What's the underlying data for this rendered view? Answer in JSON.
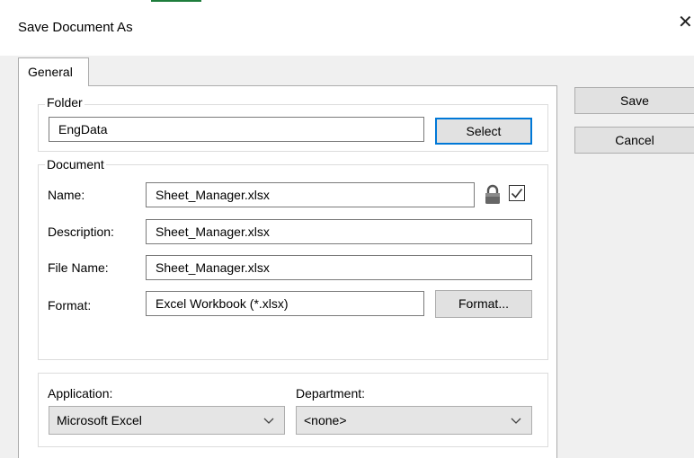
{
  "window": {
    "title": "Save Document As",
    "close_glyph": "✕"
  },
  "tabs": [
    {
      "label": "General"
    }
  ],
  "folder": {
    "legend": "Folder",
    "value": "EngData",
    "select_label": "Select"
  },
  "document": {
    "legend": "Document",
    "name": {
      "label": "Name:",
      "value": "Sheet_Manager.xlsx",
      "locked": true,
      "checked": true
    },
    "description": {
      "label": "Description:",
      "value": "Sheet_Manager.xlsx"
    },
    "file_name": {
      "label": "File Name:",
      "value": "Sheet_Manager.xlsx"
    },
    "format": {
      "label": "Format:",
      "value": "Excel Workbook (*.xlsx)",
      "button_label": "Format..."
    }
  },
  "application": {
    "label": "Application:",
    "selected": "Microsoft Excel"
  },
  "department": {
    "label": "Department:",
    "selected": "<none>"
  },
  "actions": {
    "save_label": "Save",
    "cancel_label": "Cancel"
  },
  "colors": {
    "accent": "#0078d7",
    "panel_bg": "#ffffff",
    "window_bg": "#f0f0f0",
    "button_bg": "#e1e1e1"
  }
}
